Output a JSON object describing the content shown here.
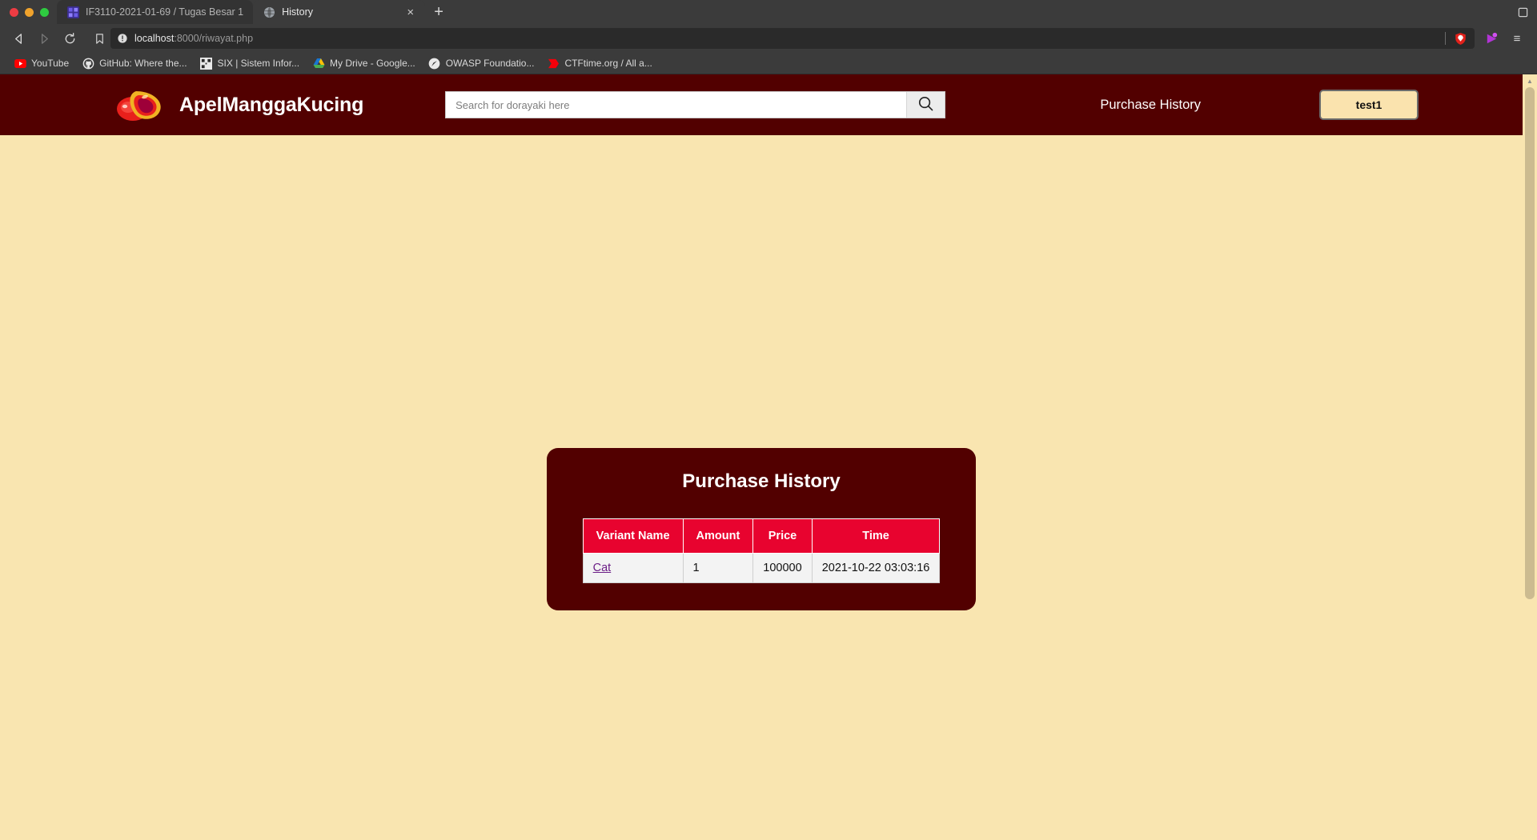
{
  "browser": {
    "window_controls": [
      "close",
      "minimize",
      "maximize"
    ],
    "tabs": [
      {
        "title": "IF3110-2021-01-69 / Tugas Besar 1",
        "favicon": "gitlab-icon",
        "active": false
      },
      {
        "title": "History",
        "favicon": "globe-icon",
        "active": true
      }
    ],
    "new_tab_label": "+",
    "close_tab_label": "×",
    "nav": {
      "back_label": "◁",
      "forward_label": "▷",
      "reload_label": "↻"
    },
    "url": {
      "host": "localhost",
      "path": ":8000/riwayat.php",
      "full": "localhost:8000/riwayat.php"
    },
    "bookmarks": [
      {
        "label": "YouTube",
        "icon": "youtube-icon"
      },
      {
        "label": "GitHub: Where the...",
        "icon": "github-icon"
      },
      {
        "label": "SIX | Sistem Infor...",
        "icon": "six-icon"
      },
      {
        "label": "My Drive - Google...",
        "icon": "google-drive-icon"
      },
      {
        "label": "OWASP Foundatio...",
        "icon": "owasp-icon"
      },
      {
        "label": "CTFtime.org / All a...",
        "icon": "ctftime-icon"
      }
    ],
    "menu_label": "≡"
  },
  "site": {
    "brand": {
      "name": "ApelManggaKucing",
      "logo_icon": "apple-mango-logo"
    },
    "search": {
      "placeholder": "Search for dorayaki here",
      "value": "",
      "button_icon": "search-icon"
    },
    "nav_link": "Purchase History",
    "user_button": "test1"
  },
  "card": {
    "title": "Purchase History",
    "table": {
      "columns": [
        "Variant Name",
        "Amount",
        "Price",
        "Time"
      ],
      "rows": [
        {
          "variant_name": "Cat",
          "amount": "1",
          "price": "100000",
          "time": "2021-10-22 03:03:16"
        }
      ]
    }
  },
  "colors": {
    "header_maroon": "#520000",
    "page_cream": "#f9e5b0",
    "table_header_red": "#e8032f",
    "button_cream": "#fae3ae",
    "link_purple": "#6b1d86"
  }
}
